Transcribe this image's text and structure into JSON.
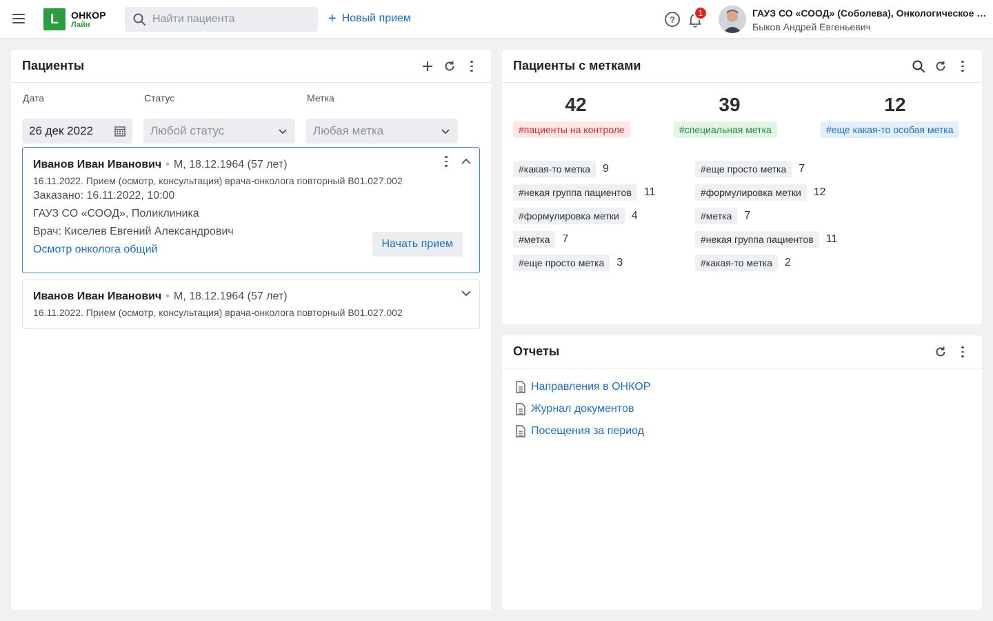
{
  "header": {
    "logo_letter": "L",
    "logo_title": "ОНКОР",
    "logo_subtitle": "Лайн",
    "search_placeholder": "Найти пациента",
    "new_visit": "Новый прием",
    "help": "?",
    "notifications_count": "1",
    "user_org": "ГАУЗ СО «СООД» (Соболева), Онкологическое отделение",
    "user_name": "Быков Андрей Евгеньевич"
  },
  "patients": {
    "title": "Пациенты",
    "filters": {
      "date_label": "Дата",
      "date_value": "26 дек 2022",
      "status_label": "Статус",
      "status_placeholder": "Любой статус",
      "tag_label": "Метка",
      "tag_placeholder": "Любая метка"
    },
    "items": [
      {
        "name": "Иванов Иван Иванович",
        "meta": "М, 18.12.1964 (57 лет)",
        "service": "16.11.2022. Прием (осмотр, консультация) врача-онколога повторный B01.027.002",
        "ordered": "Заказано: 16.11.2022, 10:00",
        "clinic": "ГАУЗ СО «СООД», Поликлиника",
        "doctor": "Врач: Киселев Евгений Александрович",
        "link": "Осмотр онколога общий",
        "action": "Начать прием"
      },
      {
        "name": "Иванов Иван Иванович",
        "meta": "М, 18.12.1964 (57 лет)",
        "service": "16.11.2022. Прием (осмотр, консультация) врача-онколога повторный B01.027.002"
      }
    ]
  },
  "tagged": {
    "title": "Пациенты с метками",
    "summary": [
      {
        "count": "42",
        "label": "#пациенты на контроле",
        "bg": "#fde7e7",
        "fg": "#d8262b"
      },
      {
        "count": "39",
        "label": "#специальная метка",
        "bg": "#e3f5e6",
        "fg": "#1f8a3a"
      },
      {
        "count": "12",
        "label": "#еще какая-то особая метка",
        "bg": "#e3eefb",
        "fg": "#1a6fc9"
      }
    ],
    "left": [
      {
        "tag": "#какая-то метка",
        "count": "9"
      },
      {
        "tag": "#некая группа пациентов",
        "count": "11"
      },
      {
        "tag": "#формулировка метки",
        "count": "4"
      },
      {
        "tag": "#метка",
        "count": "7"
      },
      {
        "tag": "#еще просто метка",
        "count": "3"
      }
    ],
    "right": [
      {
        "tag": "#еще просто метка",
        "count": "7"
      },
      {
        "tag": "#формулировка метки",
        "count": "12"
      },
      {
        "tag": "#метка",
        "count": "7"
      },
      {
        "tag": "#некая группа пациентов",
        "count": "11"
      },
      {
        "tag": "#какая-то метка",
        "count": "2"
      }
    ]
  },
  "reports": {
    "title": "Отчеты",
    "items": [
      "Направления в ОНКОР",
      "Журнал документов",
      "Посещения за период"
    ]
  },
  "colors": {
    "accent": "#1a6fc9",
    "brand": "#2a9d3f",
    "badge": "#e0201f"
  }
}
